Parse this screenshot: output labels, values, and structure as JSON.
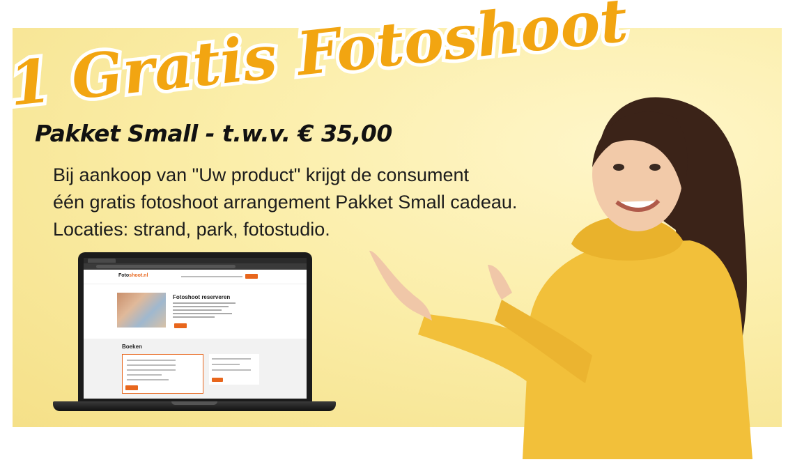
{
  "headline": "1 Gratis Fotoshoot",
  "subtitle": "Pakket Small - t.w.v. € 35,00",
  "body_lines": [
    "Bij aankoop van \"Uw product\" krijgt de consument",
    "één gratis fotoshoot arrangement Pakket Small cadeau.",
    "Locaties: strand, park, fotostudio."
  ],
  "laptop_screen": {
    "logo_main": "Foto",
    "logo_accent": "shoot.nl",
    "hero_title": "Fotoshoot reserveren",
    "book_title": "Boeken"
  },
  "colors": {
    "headline": "#f2a511",
    "headline_outline": "#ffffff",
    "accent": "#e8661c",
    "banner_bg": "#f9eaa6",
    "sweater": "#f2c03a"
  }
}
